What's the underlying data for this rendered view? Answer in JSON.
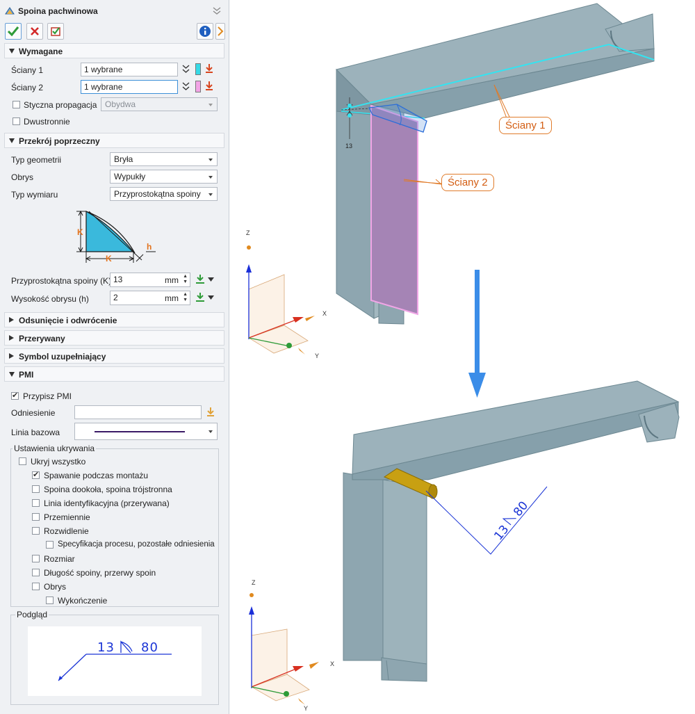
{
  "dialog": {
    "title": "Spoina pachwinowa",
    "sections": {
      "required": {
        "label": "Wymagane",
        "faces1_label": "Ściany 1",
        "faces1_value": "1 wybrane",
        "faces1_color": "#35d9e6",
        "faces2_label": "Ściany 2",
        "faces2_value": "1 wybrane",
        "faces2_color": "#f2a4e6",
        "tangent_label": "Styczna propagacja",
        "tangent_value": "Obydwa",
        "both_sides_label": "Dwustronnie"
      },
      "cross_section": {
        "label": "Przekrój poprzeczny",
        "geometry_type_label": "Typ geometrii",
        "geometry_type_value": "Bryła",
        "contour_label": "Obrys",
        "contour_value": "Wypukły",
        "dimension_type_label": "Typ wymiaru",
        "dimension_type_value": "Przyprostokątna spoiny",
        "diagram_k": "K",
        "diagram_k2": "K",
        "diagram_h": "h",
        "leg_label": "Przyprostokątna spoiny (K)",
        "leg_value": "13",
        "leg_unit": "mm",
        "height_label": "Wysokość obrysu (h)",
        "height_value": "2",
        "height_unit": "mm"
      },
      "offset": {
        "label": "Odsunięcie i odwrócenie"
      },
      "intermittent": {
        "label": "Przerywany"
      },
      "supplementary": {
        "label": "Symbol uzupełniający"
      },
      "pmi": {
        "label": "PMI",
        "assign_label": "Przypisz PMI",
        "reference_label": "Odniesienie",
        "reference_value": "",
        "baseline_label": "Linia bazowa",
        "hide_group_label": "Ustawienia ukrywania",
        "hide_items": [
          {
            "label": "Ukryj wszystko",
            "checked": false
          },
          {
            "label": "Spawanie podczas montażu",
            "checked": true
          },
          {
            "label": "Spoina dookoła, spoina trójstronna",
            "checked": false
          },
          {
            "label": "Linia identyfikacyjna (przerywana)",
            "checked": false
          },
          {
            "label": "Przemiennie",
            "checked": false
          },
          {
            "label": "Rozwidlenie",
            "checked": false
          },
          {
            "label": "Specyfikacja procesu, pozostałe odniesienia",
            "checked": false
          },
          {
            "label": "Rozmiar",
            "checked": false
          },
          {
            "label": "Długość spoiny, przerwy spoin",
            "checked": false
          },
          {
            "label": "Obrys",
            "checked": false
          },
          {
            "label": "Wykończenie",
            "checked": false
          }
        ],
        "preview_label": "Podgląd",
        "preview_left": "13",
        "preview_right": "80"
      }
    }
  },
  "viewport": {
    "callout_faces1": "Ściany 1",
    "callout_faces2": "Ściany 2",
    "dim_value": "13",
    "weld_symbol_left": "13",
    "weld_symbol_right": "80",
    "triad_top": {
      "z": "Z",
      "x": "X",
      "y": "Y"
    },
    "triad_bottom": {
      "z": "Z",
      "x": "X",
      "y": "Y"
    }
  },
  "colors": {
    "beam": "#8fa7b1",
    "beam_top": "#9fb5be",
    "face1_highlight": "#35e3f0",
    "face2_highlight": "#a583b4",
    "weld": "#c8a012",
    "annotation": "#1b35d6",
    "callout": "#e07b2a",
    "arrow": "#3b8de8",
    "accept": "#2e9b38",
    "cancel": "#d32a2a",
    "info": "#1f5fbf"
  }
}
